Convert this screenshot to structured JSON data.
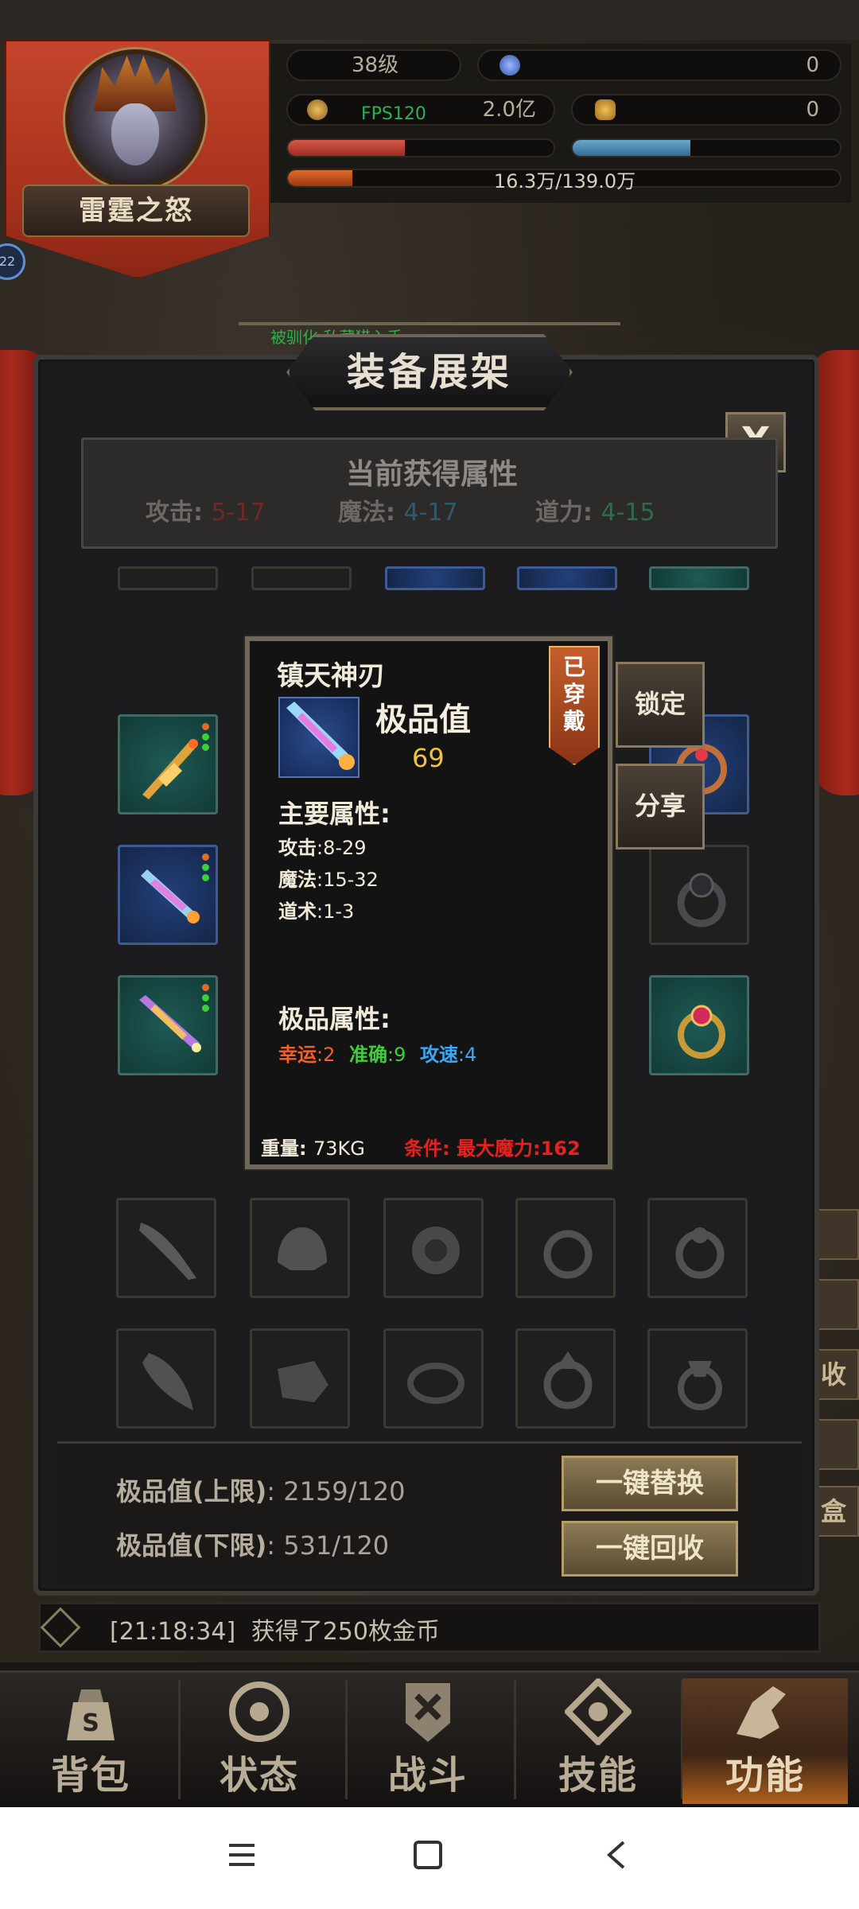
{
  "player": {
    "name": "雷霆之怒",
    "badge": "22"
  },
  "stats": {
    "level": "38级",
    "gem_count": "0",
    "fps": "FPS120",
    "gold": "2.0亿",
    "ingot_count": "0",
    "hp_fraction": 0.44,
    "mp_fraction": 0.44,
    "exp": "16.3万/139.0万",
    "exp_fraction": 0.117
  },
  "overlay_text": "被驯化  私藏猎入手",
  "panel": {
    "title": "装备展架",
    "close_label": "X",
    "current_attrs": {
      "title": "当前获得属性",
      "attack_label": "攻击",
      "attack_value": "5-17",
      "magic_label": "魔法",
      "magic_value": "4-17",
      "tao_label": "道力",
      "tao_value": "4-15"
    }
  },
  "tooltip": {
    "item_name": "镇天神刃",
    "quality_label": "极品值",
    "quality_value": "69",
    "worn_tag": "已穿戴",
    "main_attrs_title": "主要属性:",
    "main_attrs": [
      {
        "label": "攻击",
        "value": ":8-29"
      },
      {
        "label": "魔法",
        "value": ":15-32"
      },
      {
        "label": "道术",
        "value": ":1-3"
      }
    ],
    "premium_attrs_title": "极品属性:",
    "premium_attrs": [
      {
        "label": "幸运",
        "value": ":2",
        "color": "#f0602a"
      },
      {
        "label": "准确",
        "value": ":9",
        "color": "#3ccf3a"
      },
      {
        "label": "攻速",
        "value": ":4",
        "color": "#39a8f0"
      }
    ],
    "weight_label": "重量:",
    "weight_value": "73KG",
    "requirement_label": "条件:",
    "requirement_value": "最大魔力:162"
  },
  "side_buttons": {
    "lock": "锁定",
    "share": "分享"
  },
  "quality_summary": {
    "upper_label": "极品值(上限)",
    "upper_value": ": 2159/120",
    "lower_label": "极品值(下限)",
    "lower_value": ": 531/120",
    "replace_button": "一键替换",
    "recycle_button": "一键回收"
  },
  "right_edge": {
    "recycle_char": "收",
    "box_char": "盒"
  },
  "chat": {
    "timestamp": "[21:18:34]",
    "message": "获得了250枚金币"
  },
  "nav": [
    {
      "label": "背包",
      "icon": "bag-icon"
    },
    {
      "label": "状态",
      "icon": "status-icon"
    },
    {
      "label": "战斗",
      "icon": "battle-icon"
    },
    {
      "label": "技能",
      "icon": "skill-icon"
    },
    {
      "label": "功能",
      "icon": "function-icon",
      "active": true
    }
  ],
  "colors": {
    "hp": "#c8483a",
    "mp": "#4c8fb8",
    "exp": "#d0581c",
    "gold_text": "#f2c23a"
  }
}
